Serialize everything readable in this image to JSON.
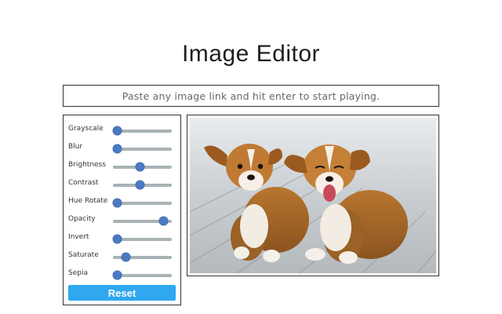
{
  "header": {
    "title": "Image Editor"
  },
  "url_input": {
    "placeholder": "Paste any image link and hit enter to start playing.",
    "value": ""
  },
  "filters": [
    {
      "label": "Grayscale",
      "value": 0
    },
    {
      "label": "Blur",
      "value": 0
    },
    {
      "label": "Brightness",
      "value": 0.45
    },
    {
      "label": "Contrast",
      "value": 0.45
    },
    {
      "label": "Hue Rotate",
      "value": 0
    },
    {
      "label": "Opacity",
      "value": 0.92
    },
    {
      "label": "Invert",
      "value": 0
    },
    {
      "label": "Saturate",
      "value": 0.18
    },
    {
      "label": "Sepia",
      "value": 0
    }
  ],
  "reset_button": {
    "label": "Reset"
  },
  "colors": {
    "accent": "#2fa8f0",
    "thumb": "#4b79c2",
    "track": "#a9b2b5"
  },
  "preview": {
    "subject": "two-puppies-photo"
  }
}
